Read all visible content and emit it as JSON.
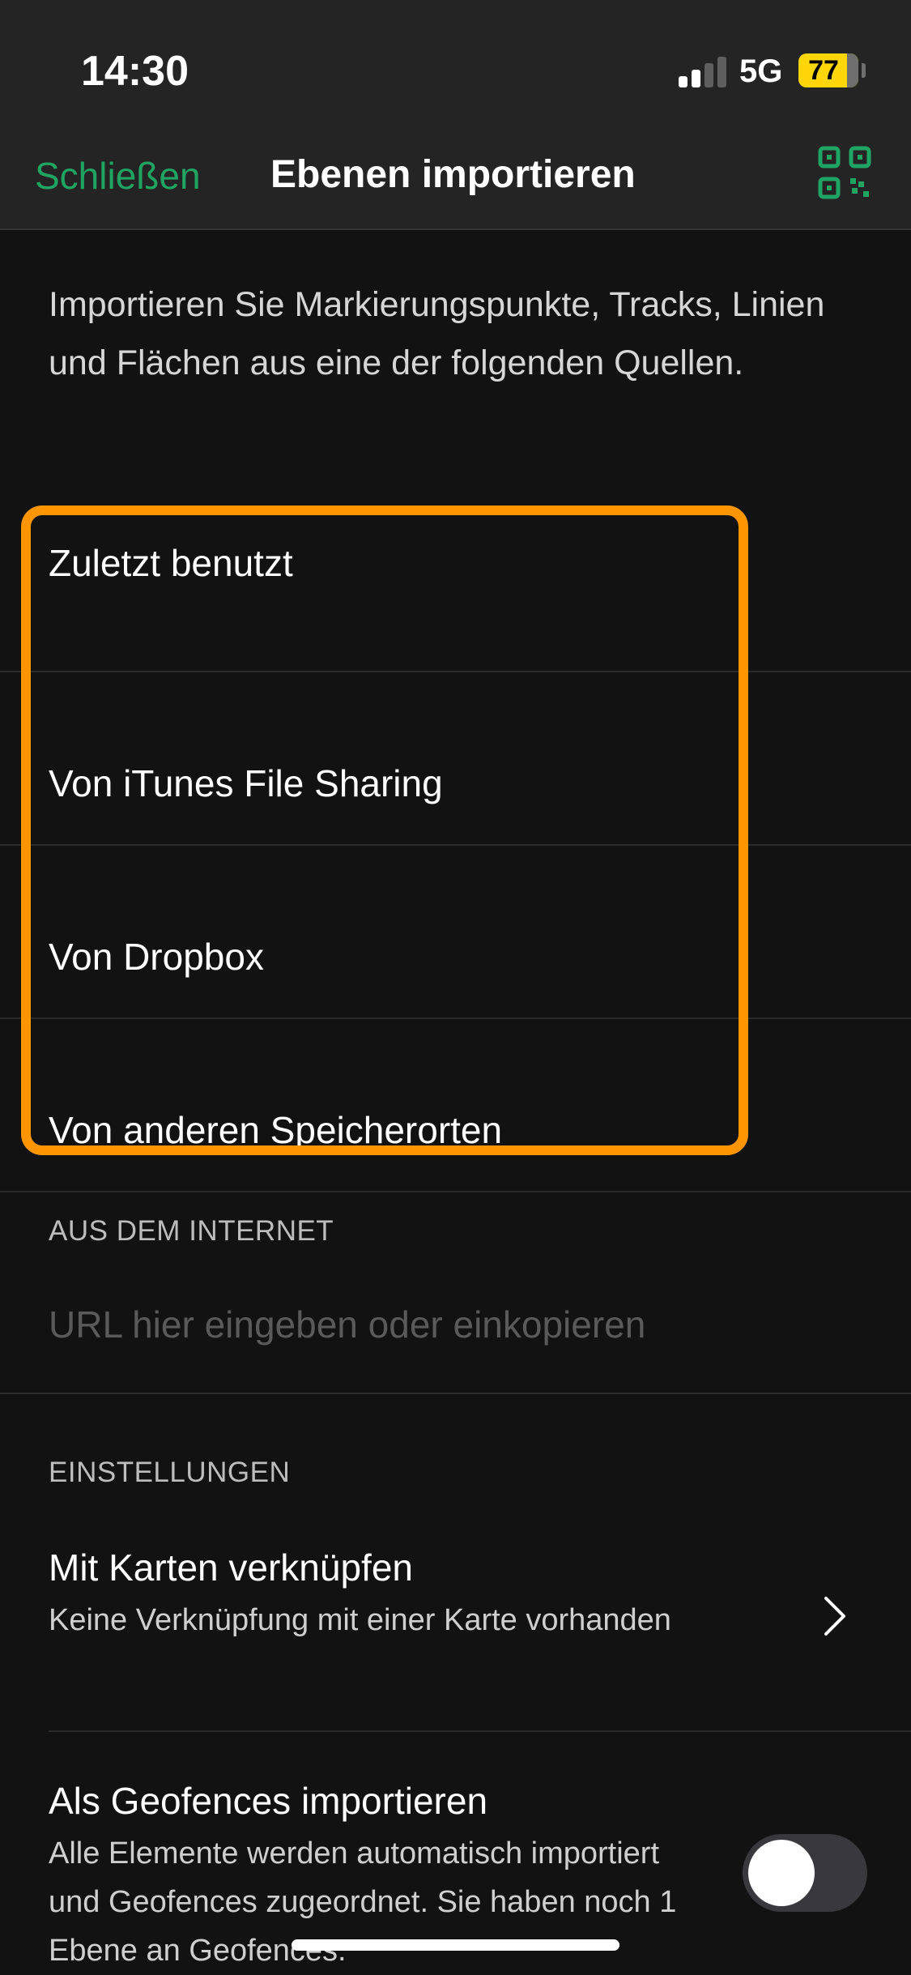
{
  "status_bar": {
    "time": "14:30",
    "network": "5G",
    "battery_level": "77"
  },
  "nav": {
    "close_label": "Schließen",
    "title": "Ebenen importieren",
    "qr_icon": "qr-code-icon"
  },
  "intro_text": "Importieren Sie Markierungspunkte, Tracks, Linien und Flächen aus eine der folgenden Quellen.",
  "sources": [
    {
      "label": "Zuletzt benutzt"
    },
    {
      "label": "Von iTunes File Sharing"
    },
    {
      "label": "Von Dropbox"
    },
    {
      "label": "Von anderen Speicherorten"
    }
  ],
  "highlight_color": "#ff9500",
  "internet": {
    "header": "AUS DEM INTERNET",
    "url_placeholder": "URL hier eingeben oder einkopieren",
    "url_value": ""
  },
  "settings": {
    "header": "EINSTELLUNGEN",
    "link_maps": {
      "title": "Mit Karten verknüpfen",
      "subtitle": "Keine Verknüpfung mit einer Karte vorhanden"
    },
    "geofences": {
      "title": "Als Geofences importieren",
      "subtitle": "Alle Elemente werden automatisch importiert und Geofences zugeordnet. Sie haben noch 1 Ebene an Geofences.",
      "enabled": false
    }
  },
  "colors": {
    "accent": "#1fa463",
    "background": "#121212",
    "bar": "#242424"
  }
}
